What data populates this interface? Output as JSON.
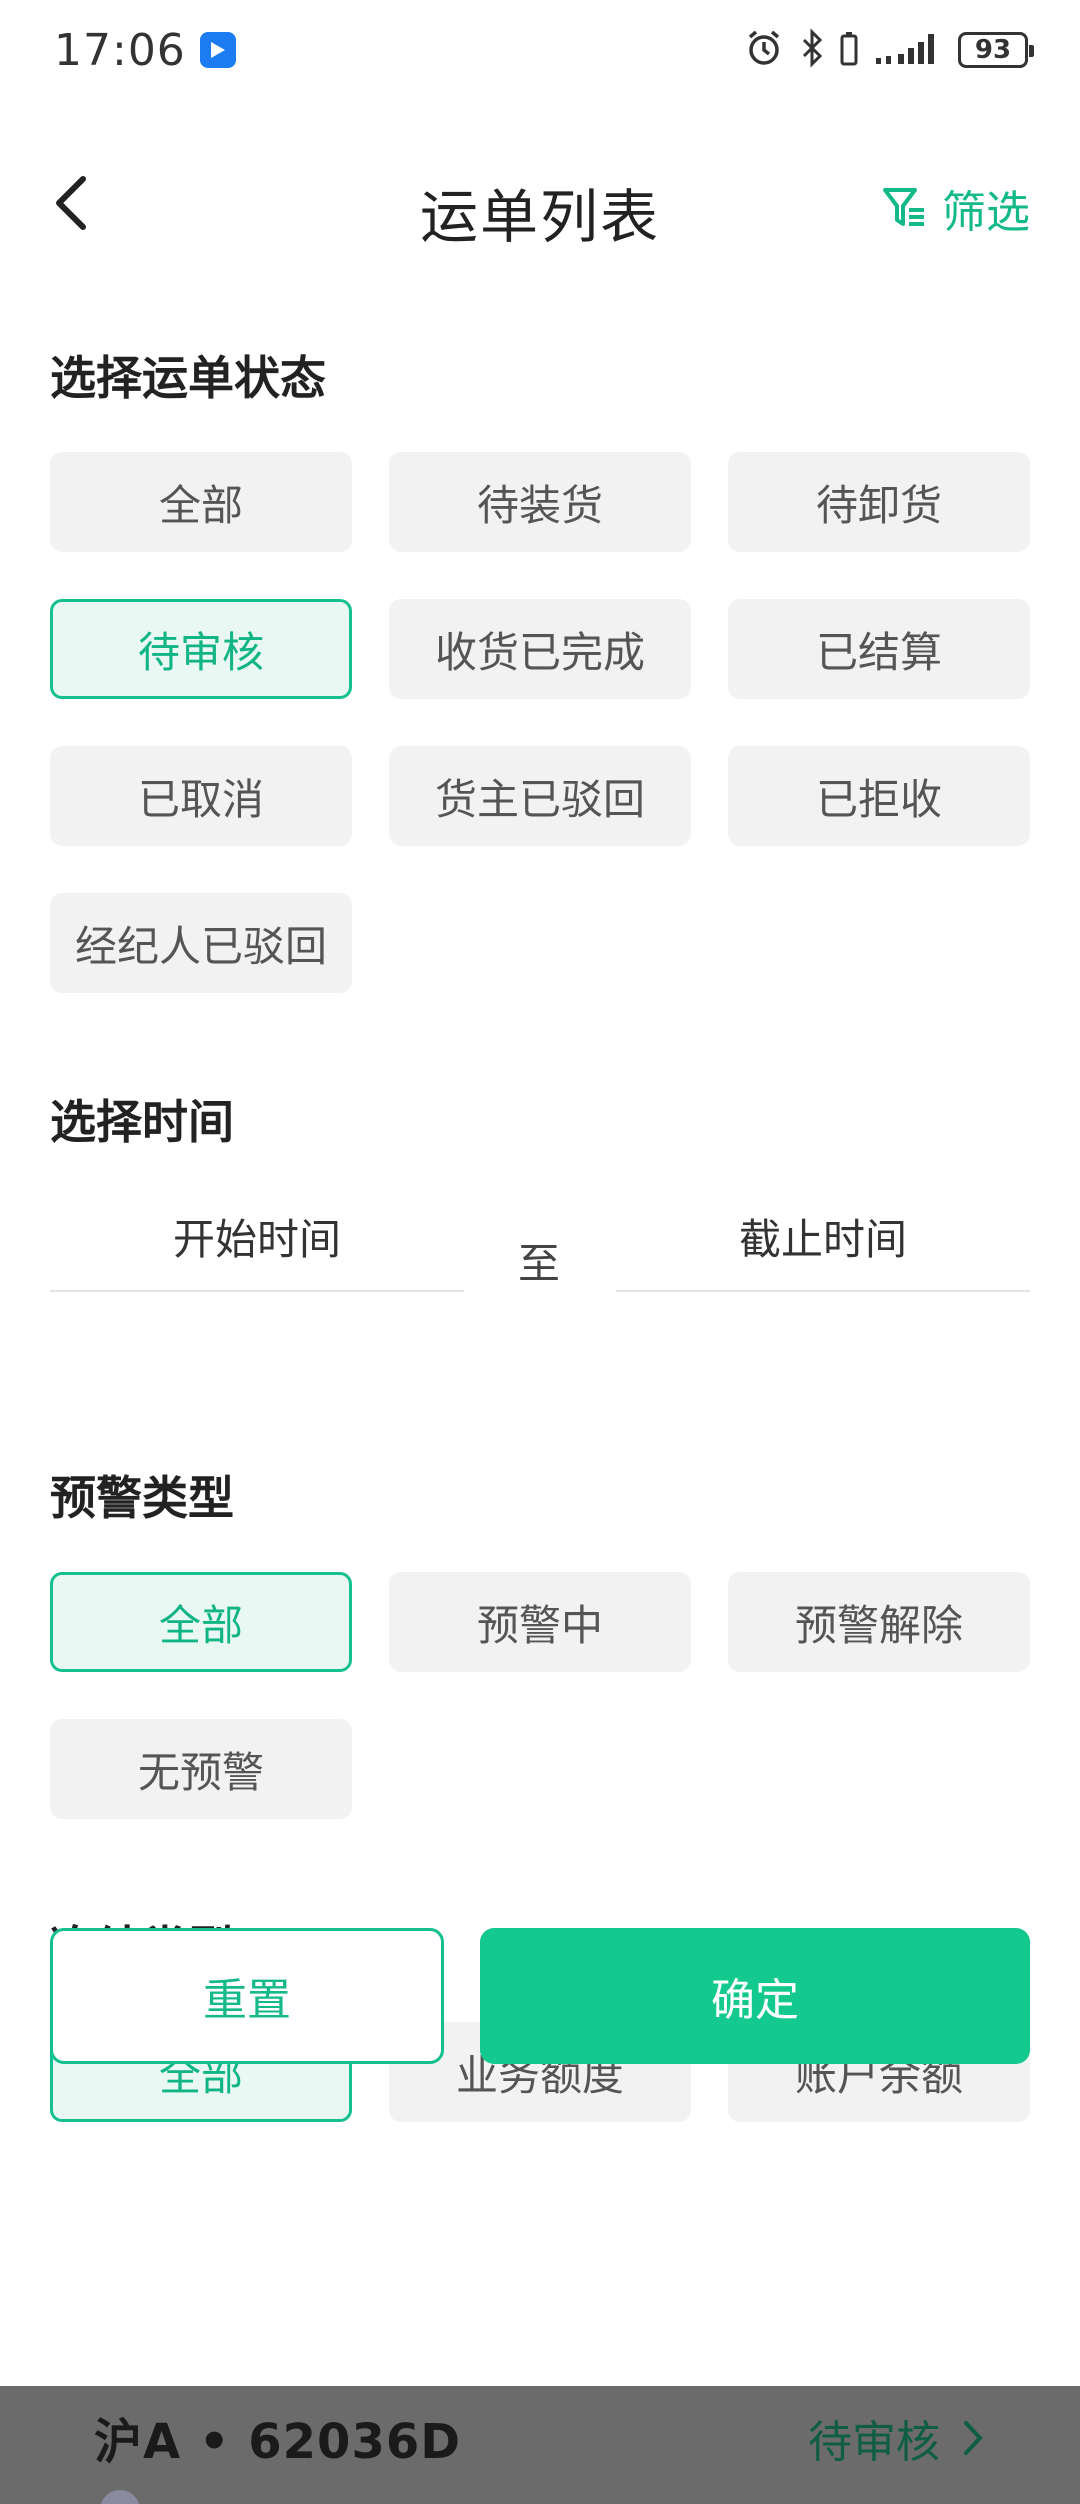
{
  "status_bar": {
    "time": "17:06",
    "battery": "93",
    "icons": [
      "alarm-icon",
      "bluetooth-icon",
      "battery-small-icon",
      "signal-icon"
    ]
  },
  "navbar": {
    "title": "运单列表",
    "filter_label": "筛选",
    "back_icon": "chevron-left-icon",
    "filter_icon": "filter-icon"
  },
  "waybill_status": {
    "title": "选择运单状态",
    "options": [
      "全部",
      "待装货",
      "待卸货",
      "待审核",
      "收货已完成",
      "已结算",
      "已取消",
      "货主已驳回",
      "已拒收",
      "经纪人已驳回"
    ],
    "selected": "待审核"
  },
  "time_select": {
    "title": "选择时间",
    "start_placeholder": "开始时间",
    "separator": "至",
    "end_placeholder": "截止时间"
  },
  "warning_type": {
    "title": "预警类型",
    "options": [
      "全部",
      "预警中",
      "预警解除",
      "无预警"
    ],
    "selected": "全部"
  },
  "freeze_type": {
    "title": "冻结类型",
    "options": [
      "全部",
      "业务额度",
      "账户余额"
    ],
    "selected": "全部"
  },
  "actions": {
    "reset": "重置",
    "confirm": "确定"
  },
  "background_card": {
    "plate": "沪A • 62036D",
    "status": "待审核"
  },
  "colors": {
    "accent": "#14c08f",
    "chip_bg": "#f2f2f3",
    "selected_bg": "#e9f8f2"
  }
}
